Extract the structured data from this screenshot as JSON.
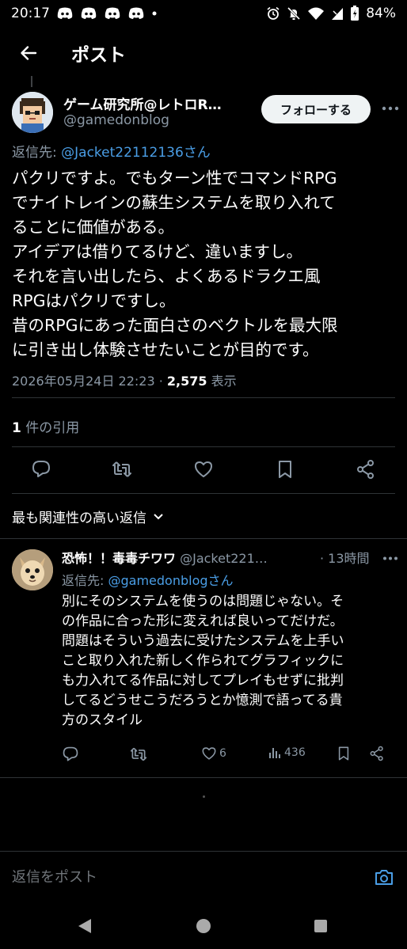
{
  "status_bar": {
    "time": "20:17",
    "battery": "84%"
  },
  "header": {
    "title": "ポスト"
  },
  "main_tweet": {
    "author_name": "ゲーム研究所@レトロR…",
    "author_handle": "@gamedonblog",
    "follow_label": "フォローする",
    "reply_to_prefix": "返信先: ",
    "reply_to_handle": "@Jacket22112136さん",
    "text_lines": [
      "パクリですよ。でもターン性でコマンドRPG",
      "でナイトレインの蘇生システムを取り入れて",
      "ることに価値がある。",
      "アイデアは借りてるけど、違いますし。",
      "それを言い出したら、よくあるドラクエ風",
      "RPGはパクリですし。",
      "昔のRPGにあった面白さのベクトルを最大限",
      "に引き出し体験させたいことが目的です。"
    ],
    "timestamp": "2026年05月24日 22:23 · ",
    "views_count": "2,575",
    "views_label": " 表示",
    "quotes_count": "1",
    "quotes_label": " 件の引用"
  },
  "sort": {
    "label": "最も関連性の高い返信"
  },
  "reply": {
    "author_name": "恐怖！！毒毒チワワ",
    "author_handle": " @Jacket221…",
    "time": "· 13時間",
    "reply_to_prefix": "返信先: ",
    "reply_to_handle": "@gamedonblogさん",
    "text_lines": [
      "別にそのシステムを使うのは問題じゃない。そ",
      "の作品に合った形に変えれば良いってだけだ。",
      "問題はそういう過去に受けたシステムを上手い",
      "こと取り入れた新しく作られてグラフィックに",
      "も力入れてる作品に対してプレイもせずに批判",
      "してるどうせこうだろうとか憶測で語ってる貴",
      "方のスタイル"
    ],
    "likes": "6",
    "views": "436"
  },
  "composer": {
    "placeholder": "返信をポスト"
  },
  "icons": {
    "back": "arrow-left-icon",
    "reply": "speech-bubble-icon",
    "repost": "repost-icon",
    "like": "heart-icon",
    "bookmark": "bookmark-icon",
    "share": "share-icon",
    "views": "bar-chart-icon",
    "camera": "camera-icon"
  },
  "colors": {
    "background": "#000000",
    "text": "#e7e9ea",
    "muted": "#8b98a5",
    "link": "#4a9ee6",
    "divider": "#2f3336"
  }
}
